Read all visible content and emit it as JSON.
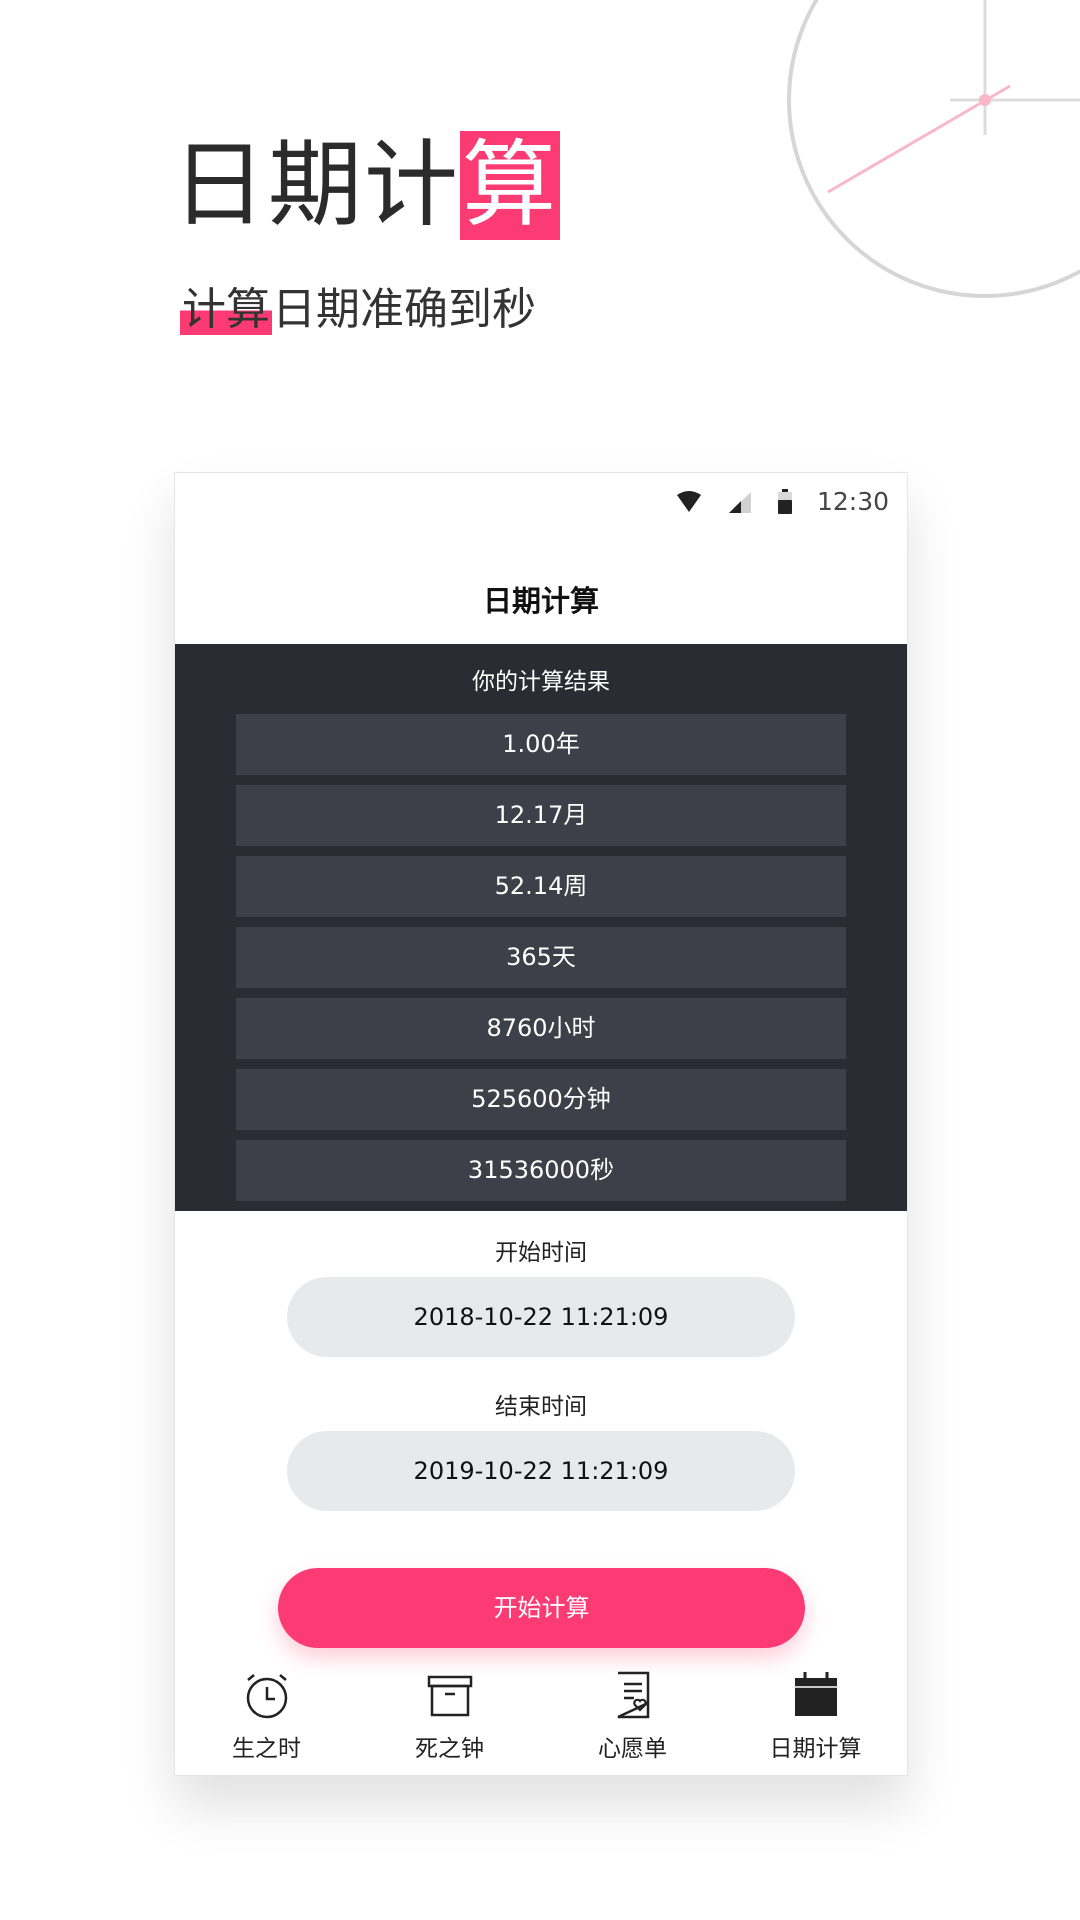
{
  "hero": {
    "title_part1": "日期计",
    "title_highlight": "算",
    "subtitle_mark": "计算",
    "subtitle_rest": "日期准确到秒"
  },
  "status_bar": {
    "time": "12:30"
  },
  "app": {
    "title": "日期计算"
  },
  "results": {
    "heading": "你的计算结果",
    "items": [
      "1.00年",
      "12.17月",
      "52.14周",
      "365天",
      "8760小时",
      "525600分钟",
      "31536000秒"
    ]
  },
  "start": {
    "label": "开始时间",
    "value": "2018-10-22 11:21:09"
  },
  "end": {
    "label": "结束时间",
    "value": "2019-10-22 11:21:09"
  },
  "action": {
    "label": "开始计算"
  },
  "tabs": [
    {
      "label": "生之时",
      "icon": "alarm-clock-icon"
    },
    {
      "label": "死之钟",
      "icon": "box-icon"
    },
    {
      "label": "心愿单",
      "icon": "wishlist-icon"
    },
    {
      "label": "日期计算",
      "icon": "calendar-icon"
    }
  ],
  "colors": {
    "accent": "#fc3a74",
    "panel": "#2a2c33",
    "row": "#3e4049",
    "pill": "#e8e9ea"
  }
}
